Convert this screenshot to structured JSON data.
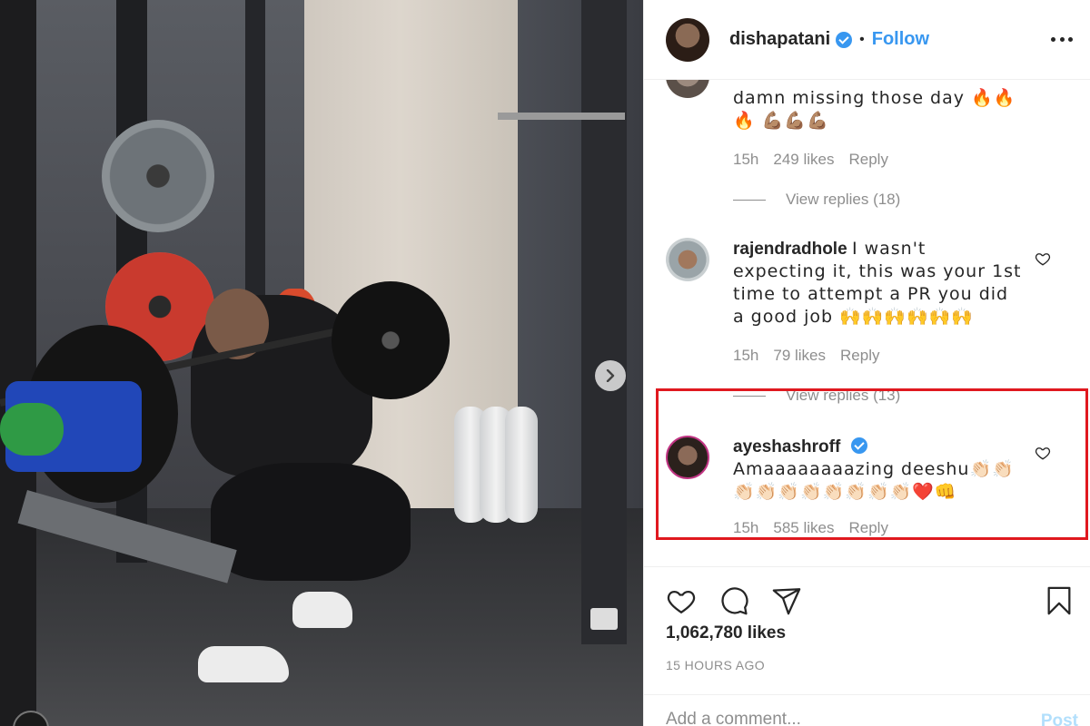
{
  "header": {
    "username": "dishapatani",
    "separator": "•",
    "follow_label": "Follow",
    "verified_icon": "verified-badge-icon",
    "more_icon": "more-options-icon"
  },
  "comments": [
    {
      "text": "damn missing those day 🔥🔥🔥 💪🏽💪🏽💪🏽",
      "time": "15h",
      "likes": "249 likes",
      "reply_label": "Reply",
      "view_replies": "View replies (18)"
    },
    {
      "username": "rajendradhole",
      "text": "I wasn't expecting it, this was your 1st time to attempt a PR you did a good job 🙌🙌🙌🙌🙌🙌",
      "time": "15h",
      "likes": "79 likes",
      "reply_label": "Reply",
      "view_replies": "View replies (13)"
    },
    {
      "username": "ayeshashroff",
      "text": "Amaaaaaaaazing deeshu👏🏻👏🏻👏🏻👏🏻👏🏻👏🏻👏🏻👏🏻👏🏻👏🏻❤️👊",
      "time": "15h",
      "likes": "585 likes",
      "reply_label": "Reply"
    }
  ],
  "actions": {
    "like_icon": "heart-icon",
    "comment_icon": "comment-icon",
    "share_icon": "share-icon",
    "save_icon": "bookmark-icon"
  },
  "likes_count": "1,062,780 likes",
  "timestamp": "15 HOURS AGO",
  "add_comment": {
    "placeholder": "Add a comment...",
    "post_label": "Post"
  },
  "colors": {
    "accent": "#3897f0",
    "highlight_border": "#e0191f",
    "muted": "#8e8e8e",
    "post_disabled": "#b2dffc"
  }
}
